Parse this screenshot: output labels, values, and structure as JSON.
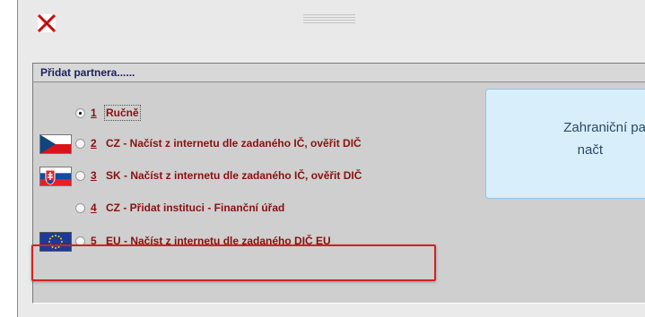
{
  "window": {
    "close_icon": "close-icon"
  },
  "panel": {
    "title": "Přidat partnera......",
    "options": [
      {
        "number": "1",
        "label": "Ručně",
        "checked": true,
        "flag": ""
      },
      {
        "number": "2",
        "label": "CZ - Načíst z internetu dle zadaného IČ, ověřit DIČ",
        "checked": false,
        "flag": "cz-flag-icon"
      },
      {
        "number": "3",
        "label": "SK - Načíst z internetu dle zadaného IČ, ověřit DIČ",
        "checked": false,
        "flag": "sk-flag-icon"
      },
      {
        "number": "4",
        "label": "CZ - Přidat instituci - Finanční úřad",
        "checked": false,
        "flag": ""
      },
      {
        "number": "5",
        "label": "EU - Načíst z internetu dle zadaného DIČ EU",
        "checked": false,
        "flag": "eu-flag-icon"
      }
    ]
  },
  "tooltip": {
    "line1": "Zahraniční pa",
    "line2": "načt"
  },
  "colors": {
    "option_text": "#8a1010",
    "highlight": "#d62121",
    "tooltip_bg": "#d9eefb",
    "close_red": "#e02020"
  }
}
